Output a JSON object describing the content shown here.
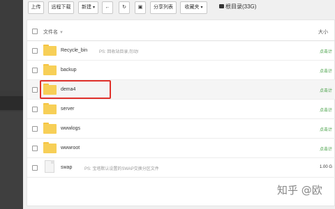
{
  "toolbar": {
    "upload_label": "上传",
    "remote_download_label": "远程下载",
    "new_label": "新建",
    "back_icon": "arrow-left-icon",
    "refresh_icon": "refresh-icon",
    "terminal_icon": "terminal-icon",
    "share_list_label": "分享列表",
    "favorites_label": "收藏夹",
    "disk_label": "根目录(33G)"
  },
  "table": {
    "header": {
      "name": "文件名",
      "size": "大小"
    },
    "rows": [
      {
        "name": "Recycle_bin",
        "note": "PS: 回收站目录,勿动!",
        "type": "folder",
        "action": "点击计"
      },
      {
        "name": "backup",
        "note": "",
        "type": "folder",
        "action": "点击计"
      },
      {
        "name": "dema4",
        "note": "",
        "type": "folder",
        "action": "点击计",
        "highlighted": true
      },
      {
        "name": "server",
        "note": "",
        "type": "folder",
        "action": "点击计"
      },
      {
        "name": "wwwlogs",
        "note": "",
        "type": "folder",
        "action": "点击计"
      },
      {
        "name": "wwwroot",
        "note": "",
        "type": "folder",
        "action": "点击计"
      },
      {
        "name": "swap",
        "note": "PS: 宝塔默认设置的SWAP交换分区文件",
        "type": "file",
        "size": "1.00 G"
      }
    ]
  },
  "watermark": "知乎 @欧",
  "colors": {
    "highlight_box": "#e0302a",
    "action_text": "#3a9a3a",
    "folder": "#f7cf57",
    "sidebar": "#3a3a3a"
  }
}
